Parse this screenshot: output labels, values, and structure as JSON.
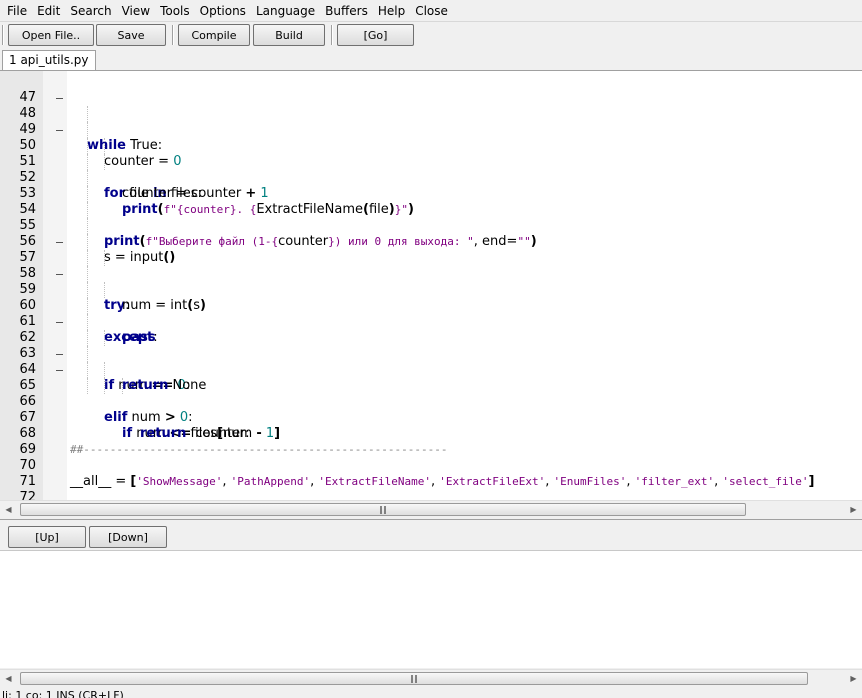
{
  "menu": {
    "items": [
      "File",
      "Edit",
      "Search",
      "View",
      "Tools",
      "Options",
      "Language",
      "Buffers",
      "Help",
      "Close"
    ]
  },
  "toolbar": {
    "open_file": "Open File..",
    "save": "Save",
    "compile": "Compile",
    "build": "Build",
    "go": "[Go]"
  },
  "tabs": {
    "active": "1 api_utils.py"
  },
  "editor": {
    "line_numbers": [
      "47",
      "48",
      "49",
      "50",
      "51",
      "52",
      "53",
      "54",
      "55",
      "56",
      "57",
      "58",
      "59",
      "60",
      "61",
      "62",
      "63",
      "64",
      "65",
      "66",
      "67",
      "68",
      "69",
      "70",
      "71",
      "72"
    ]
  },
  "output_toolbar": {
    "up": "[Up]",
    "down": "[Down]"
  },
  "status": {
    "text": "li: 1 co: 1 INS (CR+LF)"
  },
  "colors": {
    "keyword": "#00008b",
    "number": "#008080",
    "string": "#800080",
    "comment": "#808080"
  }
}
